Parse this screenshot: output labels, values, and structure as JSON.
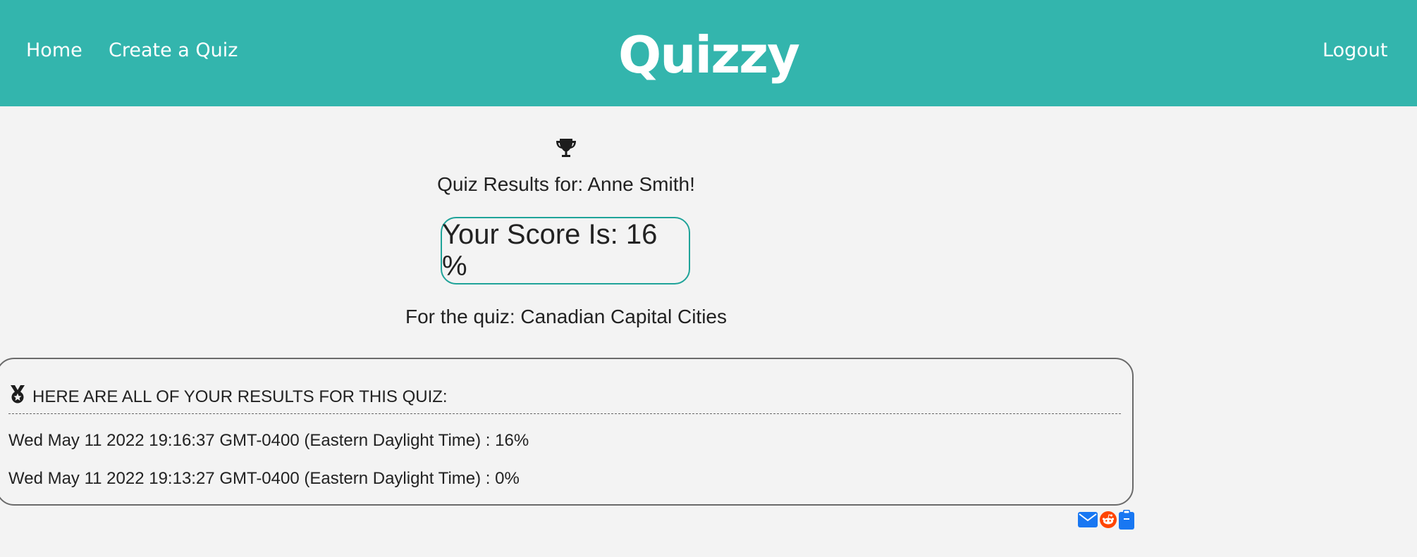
{
  "nav": {
    "home": "Home",
    "create_quiz": "Create a Quiz",
    "brand": "Quizzy",
    "logout": "Logout"
  },
  "results": {
    "trophy_icon": "trophy-icon",
    "title": "Quiz Results for: Anne Smith!",
    "score": "Your Score Is: 16 %",
    "quiz_name": "For the quiz: Canadian Capital Cities"
  },
  "history": {
    "medal_icon": "medal-icon",
    "heading": "HERE ARE ALL OF YOUR RESULTS FOR THIS QUIZ:",
    "items": [
      "Wed May 11 2022 19:16:37 GMT-0400 (Eastern Daylight Time) : 16%",
      "Wed May 11 2022 19:13:27 GMT-0400 (Eastern Daylight Time) : 0%"
    ]
  },
  "share": {
    "icons": [
      "email-icon",
      "reddit-icon",
      "clipboard-icon"
    ]
  },
  "colors": {
    "navbar": "#33b5ad",
    "accent_border": "#1fa399",
    "background": "#f3f3f3",
    "email": "#1877f2",
    "reddit": "#ff4500",
    "clipboard": "#1877f2"
  }
}
